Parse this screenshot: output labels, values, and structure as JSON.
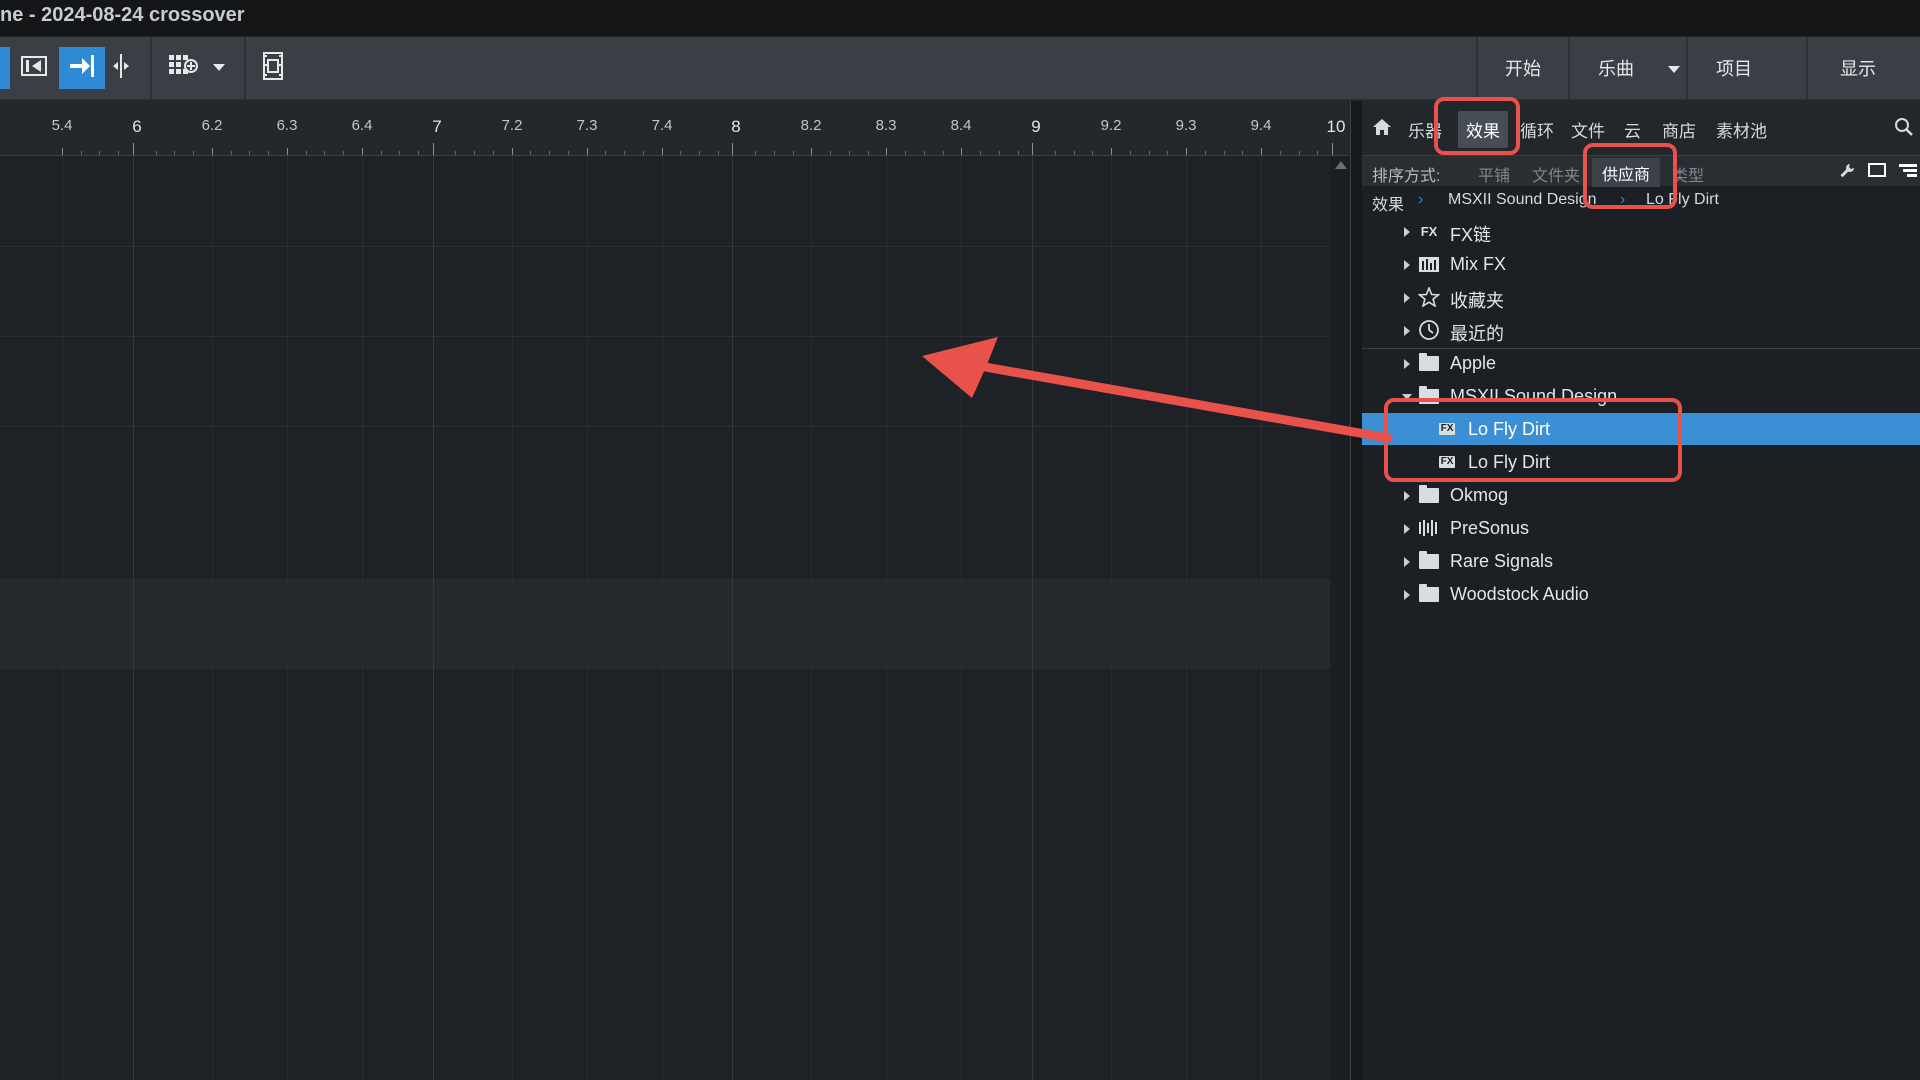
{
  "window": {
    "title": "ne - 2024-08-24 crossover"
  },
  "toolbar": {
    "tools": [
      {
        "name": "loop-prev-icon"
      },
      {
        "name": "snap-arrow-icon"
      },
      {
        "name": "split-cursor-icon"
      },
      {
        "name": "grid-add-icon"
      },
      {
        "name": "dropdown-icon"
      },
      {
        "name": "film-icon"
      }
    ],
    "nav": [
      "开始",
      "乐曲",
      "项目",
      "显示"
    ]
  },
  "ruler": {
    "labels": [
      "5.4",
      "6",
      "6.2",
      "6.3",
      "6.4",
      "7",
      "7.2",
      "7.3",
      "7.4",
      "8",
      "8.2",
      "8.3",
      "8.4",
      "9",
      "9.2",
      "9.3",
      "9.4",
      "10"
    ]
  },
  "browser": {
    "tabs": [
      "乐器",
      "效果",
      "循环",
      "文件",
      "云",
      "商店",
      "素材池"
    ],
    "active_tab": "效果",
    "sort_label": "排序方式:",
    "sort_options": [
      "平铺",
      "文件夹",
      "供应商",
      "类型"
    ],
    "active_sort": "供应商",
    "breadcrumb": [
      "效果",
      "MSXII Sound Design",
      "Lo Fly Dirt"
    ],
    "tree": [
      {
        "label": "FX链",
        "icon": "fx-chain-icon",
        "expanded": false
      },
      {
        "label": "Mix FX",
        "icon": "mix-fx-icon",
        "expanded": false
      },
      {
        "label": "收藏夹",
        "icon": "star-icon",
        "expanded": false
      },
      {
        "label": "最近的",
        "icon": "clock-icon",
        "expanded": false
      },
      {
        "label": "Apple",
        "icon": "folder-icon",
        "expanded": false
      },
      {
        "label": "MSXII Sound Design",
        "icon": "folder-icon",
        "expanded": true
      },
      {
        "label": "Lo Fly Dirt",
        "icon": "fx-plugin-icon",
        "selected": true
      },
      {
        "label": "Lo Fly Dirt",
        "icon": "fx-plugin-icon",
        "selected": false
      },
      {
        "label": "Okmog",
        "icon": "folder-icon",
        "expanded": false
      },
      {
        "label": "PreSonus",
        "icon": "presonus-icon",
        "expanded": false
      },
      {
        "label": "Rare Signals",
        "icon": "folder-icon",
        "expanded": false
      },
      {
        "label": "Woodstock Audio",
        "icon": "folder-icon",
        "expanded": false
      }
    ]
  },
  "colors": {
    "accent": "#2f8ad6",
    "selection": "#3b8fd4",
    "annotation": "#e8524b"
  }
}
